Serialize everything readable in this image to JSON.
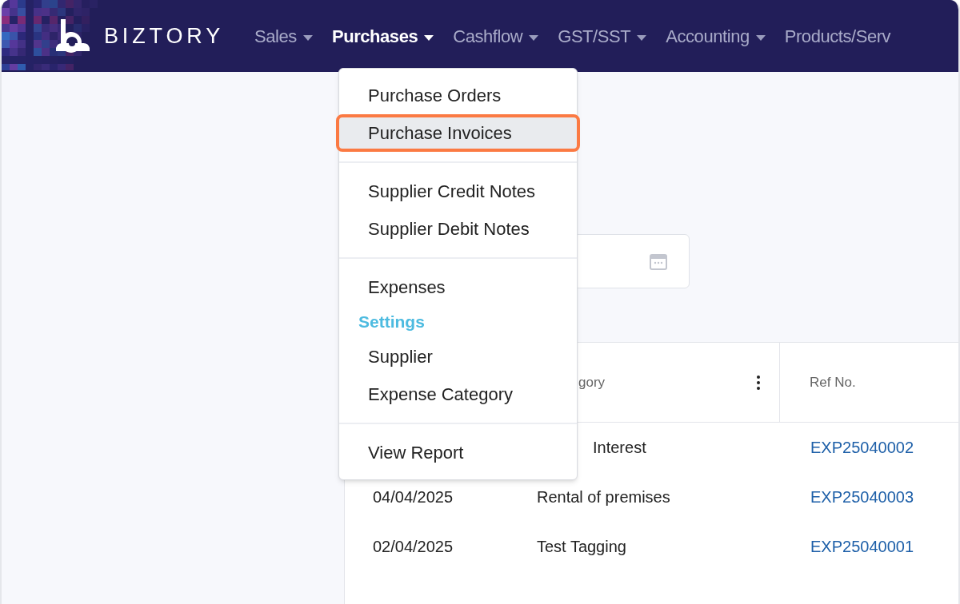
{
  "header": {
    "brand": "BIZTORY",
    "nav": [
      {
        "label": "Sales",
        "selected": false
      },
      {
        "label": "Purchases",
        "selected": true
      },
      {
        "label": "Cashflow",
        "selected": false
      },
      {
        "label": "GST/SST",
        "selected": false
      },
      {
        "label": "Accounting",
        "selected": false
      },
      {
        "label": "Products/Serv",
        "selected": false
      }
    ]
  },
  "dropdown": {
    "groups": [
      {
        "items": [
          {
            "kind": "item",
            "label": "Purchase Orders",
            "selected": false
          },
          {
            "kind": "item",
            "label": "Purchase Invoices",
            "selected": true
          }
        ]
      },
      {
        "items": [
          {
            "kind": "item",
            "label": "Supplier Credit Notes",
            "selected": false
          },
          {
            "kind": "item",
            "label": "Supplier Debit Notes",
            "selected": false
          }
        ]
      },
      {
        "items": [
          {
            "kind": "item",
            "label": "Expenses",
            "selected": false
          },
          {
            "kind": "heading",
            "label": "Settings"
          },
          {
            "kind": "item",
            "label": "Supplier",
            "selected": false
          },
          {
            "kind": "item",
            "label": "Expense Category",
            "selected": false
          }
        ]
      },
      {
        "items": [
          {
            "kind": "item",
            "label": "View Report",
            "selected": false
          }
        ]
      }
    ]
  },
  "table": {
    "columns": [
      "gory",
      "Ref No."
    ],
    "rows": [
      {
        "date": "",
        "category": "Interest",
        "ref": "EXP25040002"
      },
      {
        "date": "04/04/2025",
        "category": "Rental of premises",
        "ref": "EXP25040003"
      },
      {
        "date": "02/04/2025",
        "category": "Test Tagging",
        "ref": "EXP25040001"
      }
    ]
  }
}
